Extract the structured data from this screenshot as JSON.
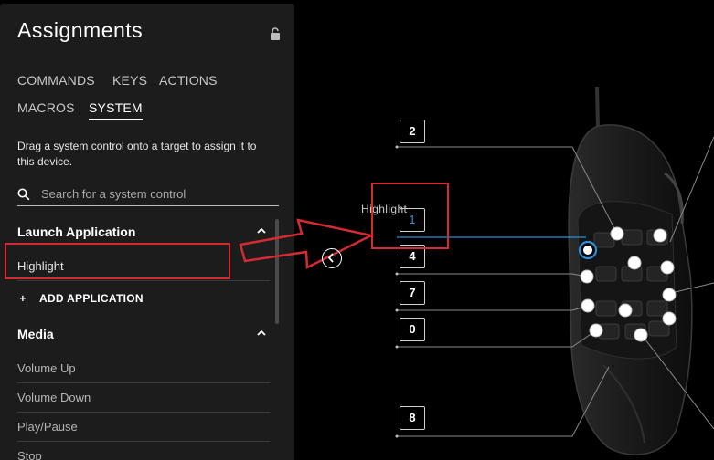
{
  "panel": {
    "title": "Assignments",
    "tabs": [
      "COMMANDS",
      "KEYS",
      "ACTIONS",
      "MACROS",
      "SYSTEM"
    ],
    "active_tab": "SYSTEM",
    "instructions": "Drag a system control onto a target to assign it to this device.",
    "search": {
      "placeholder": "Search for a system control",
      "value": ""
    },
    "sections": [
      {
        "title": "Launch Application",
        "items": [
          "Highlight"
        ],
        "add_label": "ADD APPLICATION"
      },
      {
        "title": "Media",
        "items": [
          "Volume Up",
          "Volume Down",
          "Play/Pause",
          "Stop"
        ]
      }
    ]
  },
  "canvas": {
    "button_labels": [
      "2",
      "1",
      "4",
      "7",
      "0",
      "8"
    ],
    "drag_label": "Highlight",
    "active_label": "1"
  },
  "colors": {
    "panel_bg": "#1c1c1c",
    "annotation_red": "#d42a30",
    "active_blue": "#2a8fd9"
  },
  "icons": [
    "lock-icon",
    "search-icon",
    "chevron-up-icon",
    "plus-icon",
    "chevron-left-icon",
    "arrow-annotation"
  ]
}
